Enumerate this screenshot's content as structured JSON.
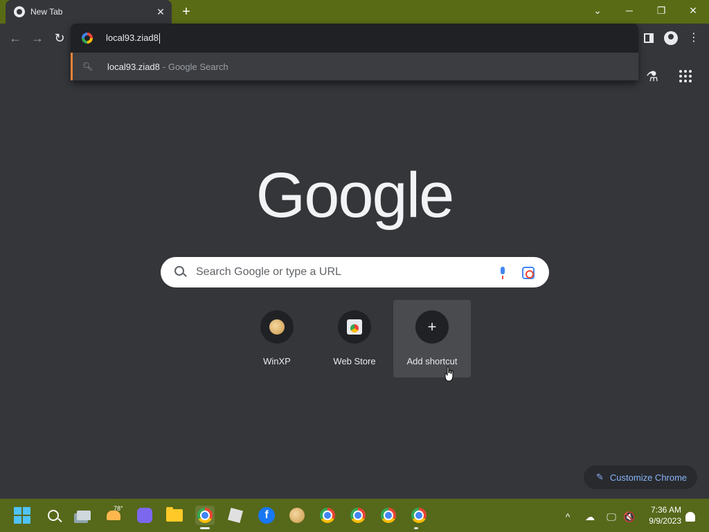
{
  "browser": {
    "tab_title": "New Tab",
    "tab_close": "✕",
    "new_tab": "+",
    "window_controls": [
      "⌄",
      "─",
      "❐",
      "✕"
    ]
  },
  "toolbar": {
    "back": "←",
    "forward": "→",
    "reload": "↻",
    "kebab": "⋮"
  },
  "omnibox": {
    "value": "local93.ziad8",
    "suggestion_text": "local93.ziad8",
    "suggestion_suffix": "- Google Search"
  },
  "page": {
    "logo": "Google",
    "search_placeholder": "Search Google or type a URL",
    "labs_icon": "⚗"
  },
  "shortcuts": [
    {
      "label": "WinXP",
      "icon": "doge-icon"
    },
    {
      "label": "Web Store",
      "icon": "webstore-icon"
    },
    {
      "label": "Add shortcut",
      "icon": "plus-icon",
      "glyph": "+"
    }
  ],
  "customize": {
    "label": "Customize Chrome",
    "icon": "✎"
  },
  "taskbar": {
    "weather_temp": "78°",
    "facebook_glyph": "f",
    "tray_chevron": "^",
    "tray_cloud": "☁",
    "tray_monitor": "🖵",
    "tray_speaker": "🔇",
    "time": "7:36 AM",
    "date": "9/9/2023"
  },
  "colors": {
    "accent_orange": "#e8833a",
    "link_blue": "#8ab4f8",
    "titlebar": "#5a6b15",
    "background": "#35363a"
  }
}
